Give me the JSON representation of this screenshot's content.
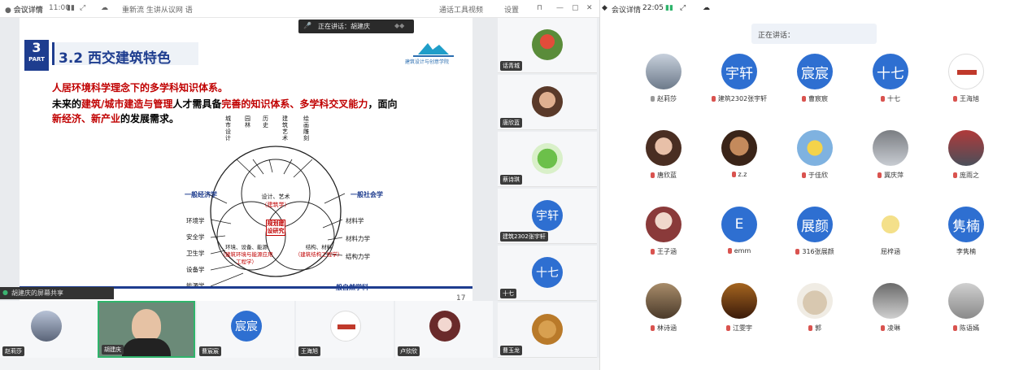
{
  "left_window": {
    "title_bar": {
      "app": "会议详情",
      "time": "11:00",
      "doc": "重新流 生讲从议网 语",
      "help": "通话工具视频",
      "settings": "设置"
    },
    "speaking_label": "正在讲话：",
    "speaking_name": "胡建庆",
    "share_label": "胡建庆的屏幕共享",
    "slide": {
      "part_number": "3",
      "part_label": "PART",
      "title": "3.2 西交建筑特色",
      "line1": "人居环境科学理念下的多学科知识体系。",
      "line2_a": "未来的",
      "line2_b": "建筑/城市建造与管理",
      "line2_c": "人才需具备",
      "line2_d": "完善的知识体系、多学科交叉能力",
      "line2_e": "，面向",
      "line3_a": "新经济、新产业",
      "line3_b": "的发展需求。",
      "logo_text": "建筑设计与创意学院",
      "page_number": "17",
      "diagram": {
        "top_labels": [
          "城市设计",
          "园林",
          "历史",
          "建筑艺术",
          "绘画雕刻"
        ],
        "left_top": "一般经济学",
        "right_top": "一般社会学",
        "left_list": [
          "环境学",
          "安全学",
          "卫生学",
          "设备学",
          "能源学"
        ],
        "right_list": [
          "材料学",
          "材料力学",
          "结构力学"
        ],
        "circle_top": "设计、艺术",
        "circle_top_sub": "（建筑学）",
        "circle_left": "环境、设备、能源",
        "circle_left_sub": "（建筑环境与能源应用工程学）",
        "circle_right": "结构、材料",
        "circle_right_sub": "（建筑结构工程学）",
        "center": "规划建设研究",
        "bottom": "一般自然学科"
      }
    },
    "side_tiles": [
      {
        "name": "话青城"
      },
      {
        "name": "唐欣蓝"
      },
      {
        "name": "蔡诗琪"
      },
      {
        "name": "建筑2302张宇轩",
        "text": "宇轩"
      },
      {
        "name": "十七",
        "text": "十七"
      },
      {
        "name": "曹玉龙"
      }
    ],
    "bottom_tiles": [
      {
        "name": "赵莉莎"
      },
      {
        "name": "胡建庆"
      },
      {
        "name": "曹宸宸",
        "text": "宸宸"
      },
      {
        "name": "王海旭"
      },
      {
        "name": "卢欣欣"
      }
    ]
  },
  "right_window": {
    "title_bar": {
      "app": "会议详情",
      "time": "22:05"
    },
    "speaking_label": "正在讲话：",
    "participants": [
      {
        "name": "赵莉莎",
        "mic": "on",
        "kind": "photo"
      },
      {
        "name": "建筑2302张宇轩",
        "mic": "off",
        "kind": "text",
        "text": "宇轩"
      },
      {
        "name": "曹宸宸",
        "mic": "off",
        "kind": "text",
        "text": "宸宸"
      },
      {
        "name": "十七",
        "mic": "off",
        "kind": "text",
        "text": "十七"
      },
      {
        "name": "王海旭",
        "mic": "off",
        "kind": "logo"
      },
      {
        "name": "唐欣蓝",
        "mic": "off",
        "kind": "photo"
      },
      {
        "name": "z.z",
        "mic": "off",
        "kind": "photo"
      },
      {
        "name": "于佳欣",
        "mic": "off",
        "kind": "photo"
      },
      {
        "name": "冀庆萍",
        "mic": "off",
        "kind": "photo"
      },
      {
        "name": "庞雨之",
        "mic": "off",
        "kind": "photo"
      },
      {
        "name": "王子涵",
        "mic": "off",
        "kind": "photo"
      },
      {
        "name": "emm",
        "mic": "off",
        "kind": "text",
        "text": "E"
      },
      {
        "name": "316张展颜",
        "mic": "off",
        "kind": "text",
        "text": "展颜"
      },
      {
        "name": "屈梓涵",
        "mic": "none",
        "kind": "photo"
      },
      {
        "name": "李隽楠",
        "mic": "none",
        "kind": "text",
        "text": "隽楠"
      },
      {
        "name": "林诗涵",
        "mic": "off",
        "kind": "photo"
      },
      {
        "name": "江雯宇",
        "mic": "off",
        "kind": "photo"
      },
      {
        "name": "郭",
        "mic": "off",
        "kind": "photo"
      },
      {
        "name": "凌琳",
        "mic": "off",
        "kind": "photo"
      },
      {
        "name": "陈语嫣",
        "mic": "off",
        "kind": "photo"
      }
    ]
  },
  "colors": {
    "accent_blue": "#2e6fd1",
    "slide_navy": "#1e3d8f",
    "slide_red": "#c00000",
    "active_border": "#2fb46b"
  }
}
